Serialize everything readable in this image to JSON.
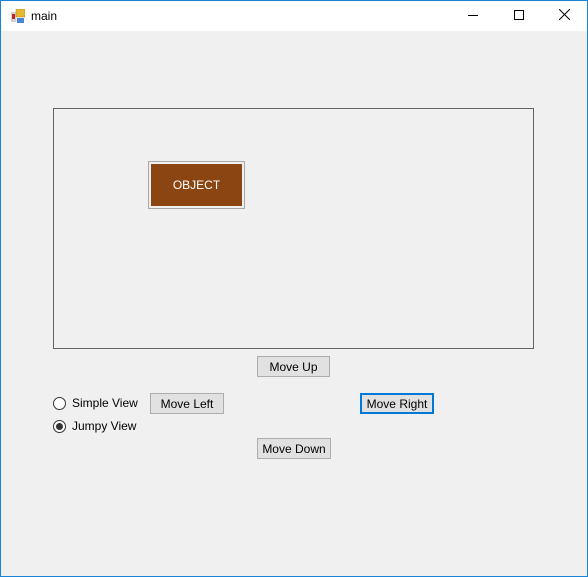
{
  "window": {
    "title": "main",
    "icon": "app-form-icon",
    "controls": {
      "minimize": "minimize-icon",
      "maximize": "maximize-icon",
      "close": "close-icon"
    }
  },
  "canvas": {
    "object_label": "OBJECT",
    "object_color": "#8b4513"
  },
  "buttons": {
    "move_up": "Move Up",
    "move_left": "Move Left",
    "move_right": "Move Right",
    "move_down": "Move Down"
  },
  "view_mode": {
    "options": [
      {
        "label": "Simple View",
        "checked": false
      },
      {
        "label": "Jumpy View",
        "checked": true
      }
    ]
  },
  "accent_color": "#0078d7"
}
